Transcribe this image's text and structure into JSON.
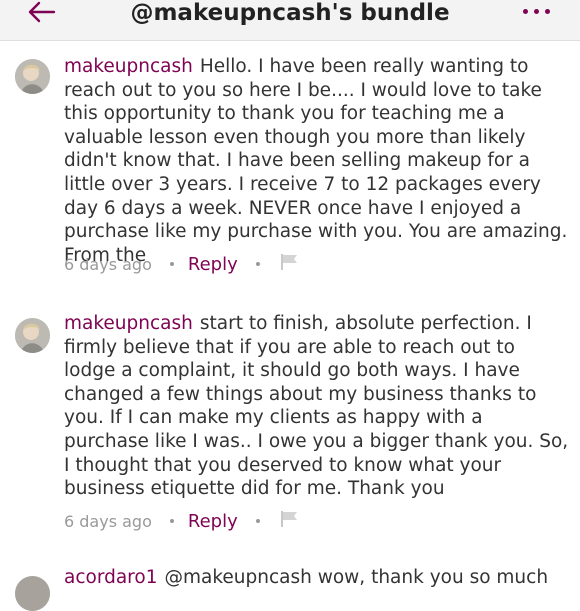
{
  "header": {
    "title": "@makeupncash's bundle",
    "back_icon": "arrow-left-icon",
    "menu_icon": "more-horizontal-icon"
  },
  "comments": [
    {
      "username": "makeupncash",
      "text": "Hello. I have been really wanting to reach out to you so here I be.... I would love to take this opportunity to thank you for teaching me a valuable lesson even though you more than likely didn't know that. I have been selling makeup for a little over 3 years. I receive 7 to 12 packages every day 6 days a week. NEVER once have I enjoyed a purchase like my purchase with you. You are amazing. From the",
      "time": "6 days ago",
      "reply_label": "Reply",
      "flag_icon": "flag-icon"
    },
    {
      "username": "makeupncash",
      "text": "start to finish, absolute perfection. I firmly believe that if you are able to reach out to lodge a complaint, it should go both ways. I have changed a few things about my business thanks to you. If I can make my clients as happy with a purchase like I was.. I owe you a bigger thank you. So, I thought that you deserved to know what your business etiquette did for me. Thank you",
      "time": "6 days ago",
      "reply_label": "Reply",
      "flag_icon": "flag-icon"
    },
    {
      "username": "acordaro1",
      "text": "@makeupncash wow, thank you so much"
    }
  ],
  "colors": {
    "accent": "#7f0353",
    "muted": "#999999",
    "header_bg": "#f4f3f3"
  }
}
